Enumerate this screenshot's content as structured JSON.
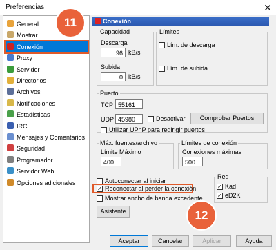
{
  "window": {
    "title": "Preferencias",
    "close_glyph": "✕"
  },
  "sidebar": {
    "items": [
      {
        "label": "General",
        "icon": "general-icon",
        "color": "#e8a33b"
      },
      {
        "label": "Mostrar",
        "icon": "display-icon",
        "color": "#c9a86a"
      },
      {
        "label": "Conexión",
        "icon": "connection-icon",
        "color": "#cc2222"
      },
      {
        "label": "Proxy",
        "icon": "proxy-icon",
        "color": "#4a7bd0"
      },
      {
        "label": "Servidor",
        "icon": "server-icon",
        "color": "#3b9c3b"
      },
      {
        "label": "Directorios",
        "icon": "folder-icon",
        "color": "#e2b03a"
      },
      {
        "label": "Archivos",
        "icon": "files-icon",
        "color": "#5c6f99"
      },
      {
        "label": "Notificaciones",
        "icon": "notifications-icon",
        "color": "#d8b84a"
      },
      {
        "label": "Estadísticas",
        "icon": "statistics-icon",
        "color": "#4aa04a"
      },
      {
        "label": "IRC",
        "icon": "irc-icon",
        "color": "#3a5fb0"
      },
      {
        "label": "Mensajes y Comentarios",
        "icon": "messages-icon",
        "color": "#6a8fd0"
      },
      {
        "label": "Seguridad",
        "icon": "security-icon",
        "color": "#d04040"
      },
      {
        "label": "Programador",
        "icon": "scheduler-icon",
        "color": "#7f7f7f"
      },
      {
        "label": "Servidor Web",
        "icon": "webserver-icon",
        "color": "#3a90c8"
      },
      {
        "label": "Opciones adicionales",
        "icon": "advanced-icon",
        "color": "#d08a2a"
      }
    ],
    "selected_index": 2
  },
  "panel": {
    "header": "Conexión",
    "capacity": {
      "title": "Capacidad",
      "download_label": "Descarga",
      "download_value": "96",
      "download_unit": "kB/s",
      "upload_label": "Subida",
      "upload_value": "0",
      "upload_unit": "kB/s"
    },
    "limits": {
      "title": "Límites",
      "download_limit_label": "Lím. de descarga",
      "download_limit_checked": false,
      "upload_limit_label": "Lím. de subida",
      "upload_limit_checked": false
    },
    "port": {
      "title": "Puerto",
      "tcp_label": "TCP",
      "tcp_value": "55161",
      "udp_label": "UDP",
      "udp_value": "45980",
      "disable_label": "Desactivar",
      "disable_checked": false,
      "test_button": "Comprobar Puertos",
      "upnp_label": "Utilizar UPnP para redirigir puertos",
      "upnp_checked": false
    },
    "max_sources": {
      "title": "Máx. fuentes/archivo",
      "hard_limit_label": "Límite Máximo",
      "hard_limit_value": "400"
    },
    "conn_limits": {
      "title": "Límites de conexión",
      "max_connections_label": "Conexiones máximas",
      "max_connections_value": "500"
    },
    "autoconnect": {
      "label": "Autoconectar al iniciar",
      "checked": false
    },
    "reconnect": {
      "label": "Reconectar al perder la conexión",
      "checked": true
    },
    "overhead": {
      "label": "Mostrar ancho de banda excedente",
      "checked": false
    },
    "network": {
      "title": "Red",
      "kad_label": "Kad",
      "kad_checked": true,
      "ed2k_label": "eD2K",
      "ed2k_checked": true
    },
    "wizard_button": "Asistente"
  },
  "footer": {
    "ok": "Aceptar",
    "cancel": "Cancelar",
    "apply": "Aplicar",
    "help": "Ayuda"
  },
  "annotations": {
    "badge_one": "11",
    "badge_two": "12",
    "color": "#e9623a"
  }
}
